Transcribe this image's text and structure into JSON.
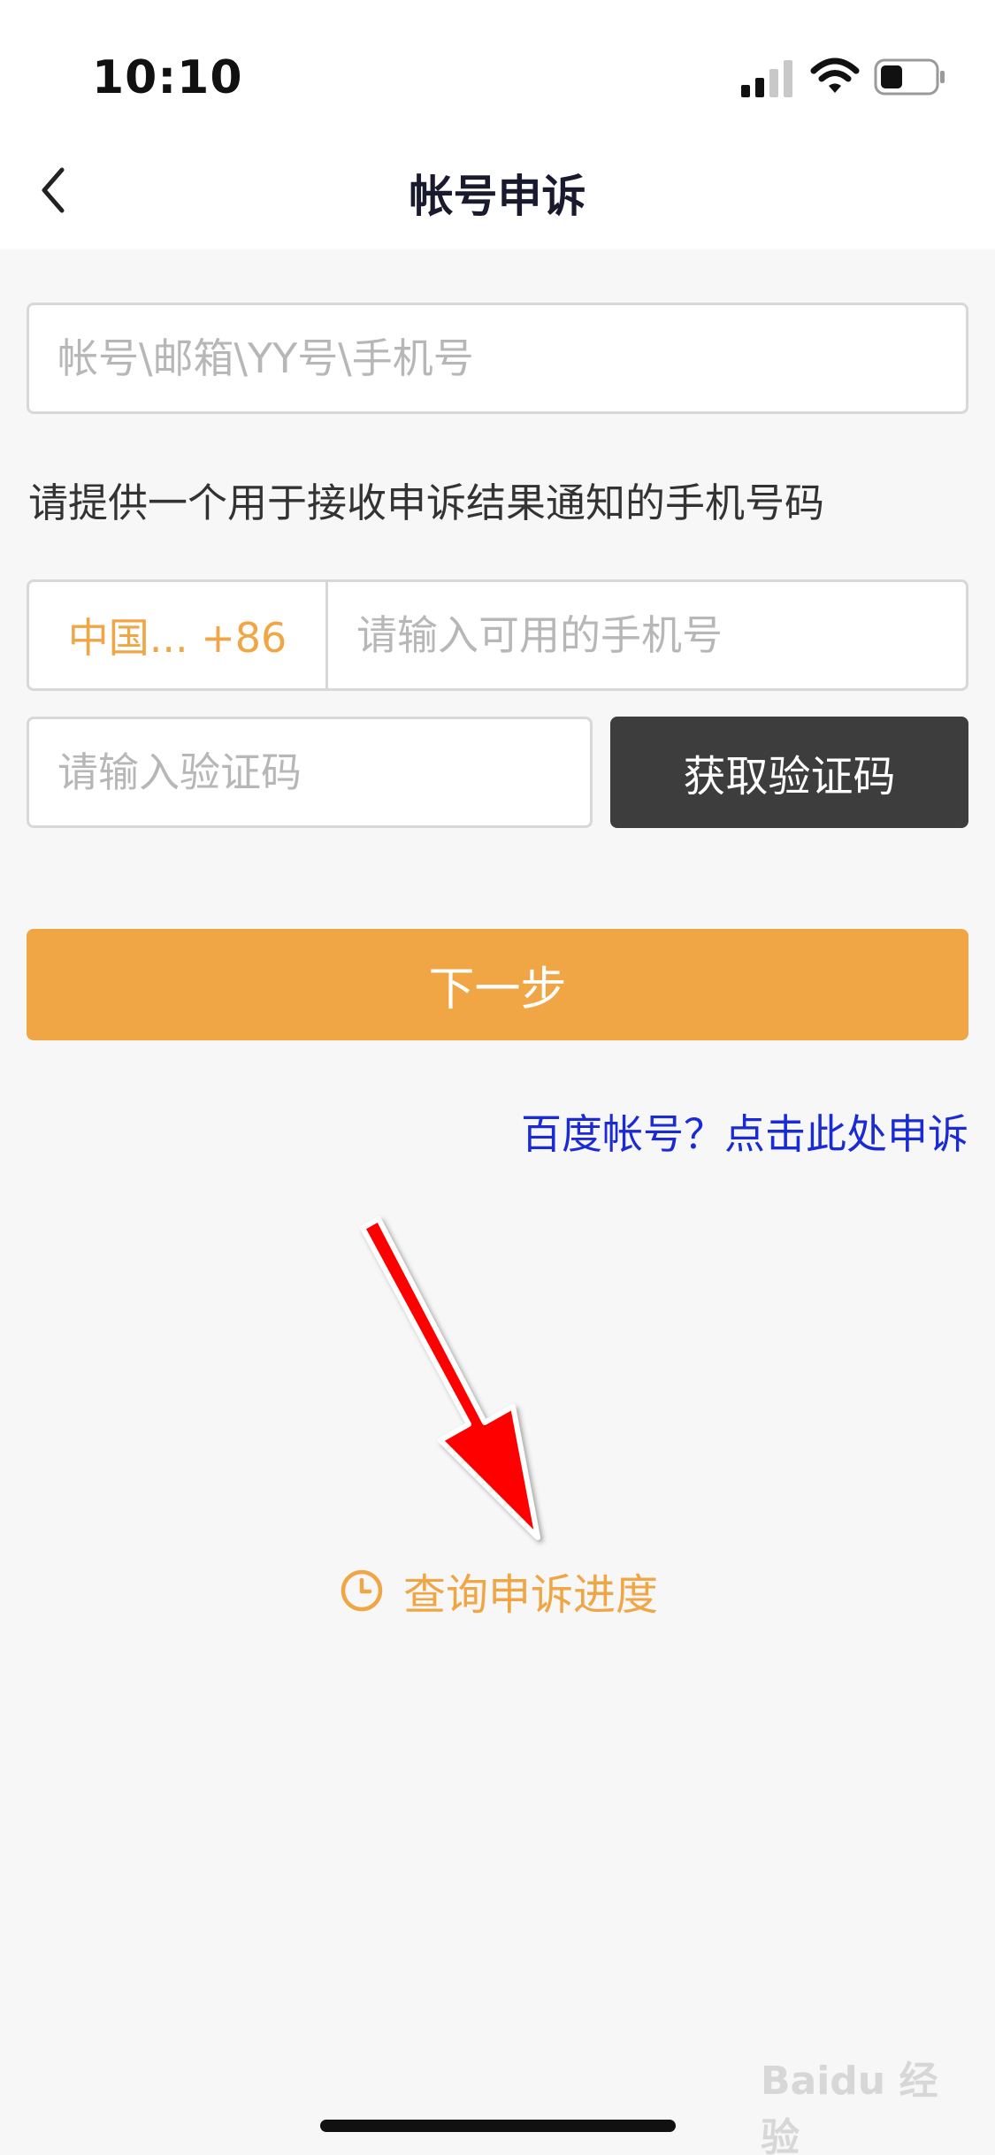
{
  "status_bar": {
    "time": "10:10"
  },
  "nav": {
    "title": "帐号申诉"
  },
  "form": {
    "account_placeholder": "帐号\\邮箱\\YY号\\手机号",
    "notice": "请提供一个用于接收申诉结果通知的手机号码",
    "country_code": "中国... +86",
    "phone_placeholder": "请输入可用的手机号",
    "code_placeholder": "请输入验证码",
    "get_code_label": "获取验证码",
    "next_label": "下一步"
  },
  "links": {
    "baidu_appeal": "百度帐号？点击此处申诉",
    "progress": "查询申诉进度"
  },
  "watermark": "Baidu 经验",
  "colors": {
    "accent": "#f0a645",
    "dark_button": "#3d3d3d",
    "link_blue": "#1a2bd6",
    "annotation_arrow": "#ff0000"
  }
}
